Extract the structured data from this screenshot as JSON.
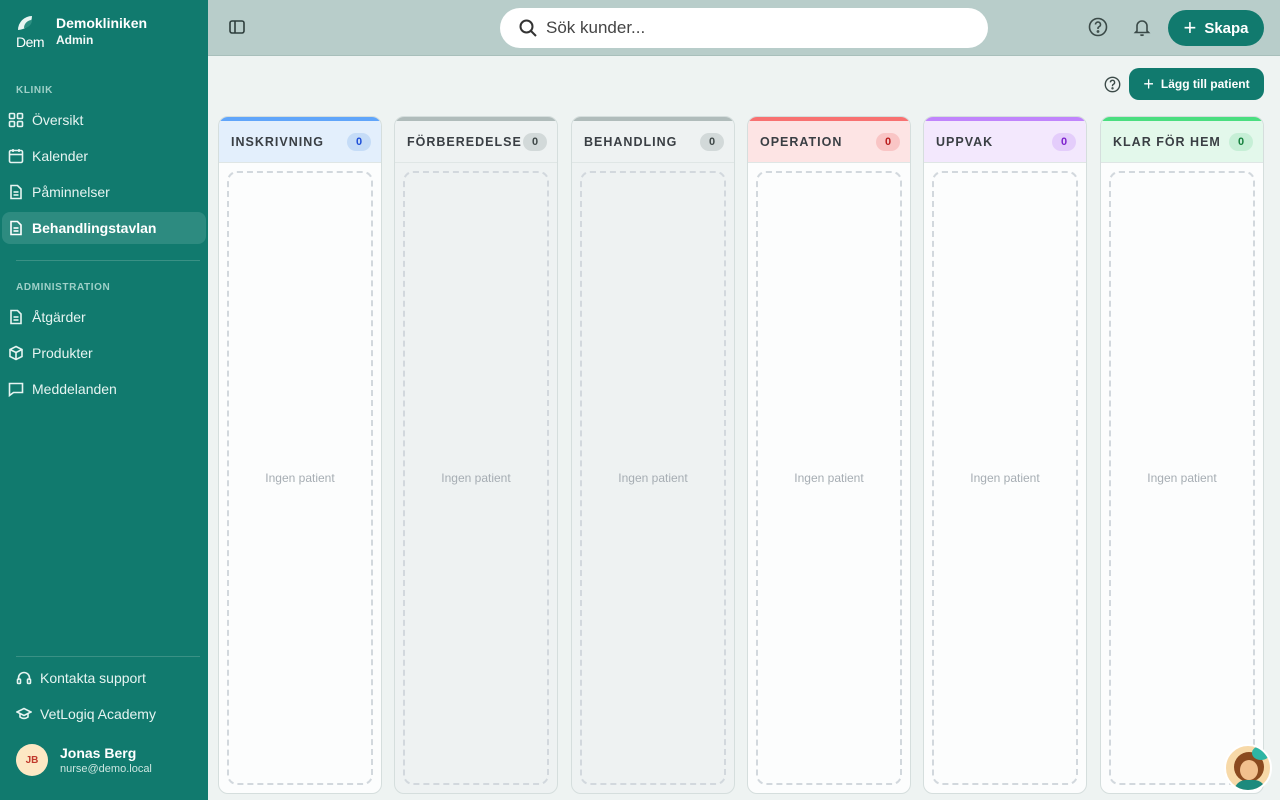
{
  "brand": {
    "name": "Demokliniken",
    "role": "Admin",
    "logo_fragment": "Dem"
  },
  "sidebar": {
    "section_klinik": "KLINIK",
    "section_admin": "ADMINISTRATION",
    "items": [
      {
        "label": "Översikt",
        "icon": "grid-icon"
      },
      {
        "label": "Kalender",
        "icon": "calendar-icon"
      },
      {
        "label": "Påminnelser",
        "icon": "document-icon"
      },
      {
        "label": "Behandlingstavlan",
        "icon": "document-icon",
        "active": true
      }
    ],
    "admin_items": [
      {
        "label": "Åtgärder",
        "icon": "document-icon"
      },
      {
        "label": "Produkter",
        "icon": "package-icon"
      },
      {
        "label": "Meddelanden",
        "icon": "message-icon"
      }
    ],
    "support": "Kontakta support",
    "academy": "VetLogiq Academy"
  },
  "user": {
    "initials": "JB",
    "name": "Jonas Berg",
    "email": "nurse@demo.local"
  },
  "topbar": {
    "search_placeholder": "Sök kunder...",
    "create_label": "Skapa"
  },
  "board": {
    "add_patient_label": "Lägg till patient",
    "empty_text": "Ingen patient",
    "columns": [
      {
        "title": "INSKRIVNING",
        "count": "0",
        "accent": "#60a5fa",
        "head_bg": "#e3effc",
        "badge_bg": "#c5dcf7",
        "badge_fg": "#1d4ed8"
      },
      {
        "title": "FÖRBEREDELSE",
        "count": "0",
        "accent": "#b0bcbb",
        "head_bg": "#eef2f2",
        "badge_bg": "#d2d9d9",
        "badge_fg": "#3f4848"
      },
      {
        "title": "BEHANDLING",
        "count": "0",
        "accent": "#b0bcbb",
        "head_bg": "#eef2f2",
        "badge_bg": "#d2d9d9",
        "badge_fg": "#3f4848"
      },
      {
        "title": "OPERATION",
        "count": "0",
        "accent": "#f87171",
        "head_bg": "#fde4e4",
        "badge_bg": "#f9c5c5",
        "badge_fg": "#b91c1c"
      },
      {
        "title": "UPPVAK",
        "count": "0",
        "accent": "#c084fc",
        "head_bg": "#f3e8fd",
        "badge_bg": "#e4cdfb",
        "badge_fg": "#7e22ce"
      },
      {
        "title": "KLAR FÖR HEM",
        "count": "0",
        "accent": "#4ade80",
        "head_bg": "#e3f8eb",
        "badge_bg": "#c6efd6",
        "badge_fg": "#15803d"
      }
    ]
  }
}
